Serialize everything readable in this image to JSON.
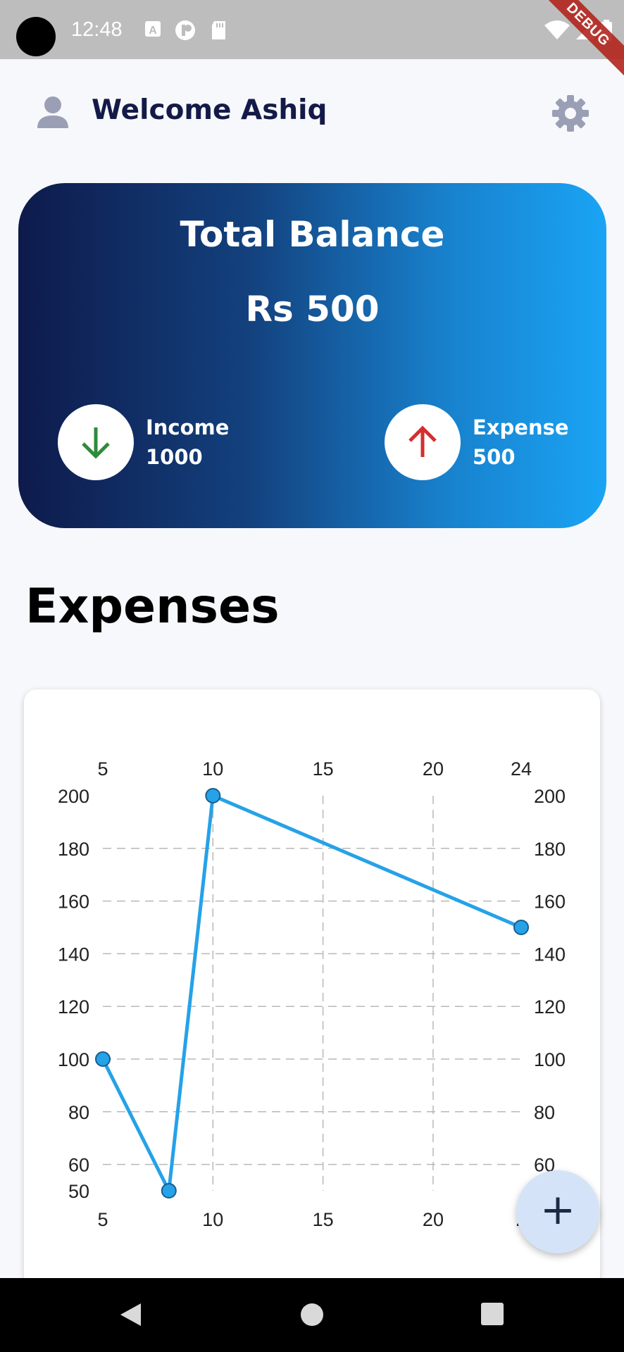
{
  "status_bar": {
    "time": "12:48",
    "debug_banner": "DEBUG",
    "icons": [
      "notification-a-icon",
      "app-icon",
      "sd-card-icon",
      "wifi-icon",
      "signal-icon",
      "battery-icon"
    ]
  },
  "header": {
    "welcome_text": "Welcome Ashiq",
    "avatar_icon": "person-icon",
    "settings_icon": "gear-icon"
  },
  "balance_card": {
    "title": "Total Balance",
    "amount": "Rs 500",
    "income": {
      "label": "Income",
      "value": "1000",
      "icon": "arrow-down-icon",
      "color": "#2E8B3A"
    },
    "expense": {
      "label": "Expense",
      "value": "500",
      "icon": "arrow-up-icon",
      "color": "#D32F2F"
    },
    "gradient": [
      "#0E1A4B",
      "#1AA4F5"
    ]
  },
  "expenses": {
    "title": "Expenses"
  },
  "chart_data": {
    "type": "line",
    "x": [
      5,
      8,
      10,
      24
    ],
    "y": [
      100,
      50,
      200,
      150
    ],
    "xlim": [
      5,
      24
    ],
    "ylim": [
      50,
      200
    ],
    "x_ticks_top": [
      "5",
      "10",
      "15",
      "20",
      "24"
    ],
    "x_ticks_bottom": [
      "5",
      "10",
      "15",
      "20",
      "2"
    ],
    "y_ticks": [
      "200",
      "180",
      "160",
      "140",
      "120",
      "100",
      "80",
      "60",
      "50"
    ],
    "grid": true,
    "line_color": "#25A2E8",
    "title": "",
    "xlabel": "",
    "ylabel": ""
  },
  "fab": {
    "label": "+",
    "icon": "plus-icon"
  },
  "nav_bar": {
    "buttons": [
      "back-icon",
      "home-icon",
      "recents-icon"
    ]
  }
}
